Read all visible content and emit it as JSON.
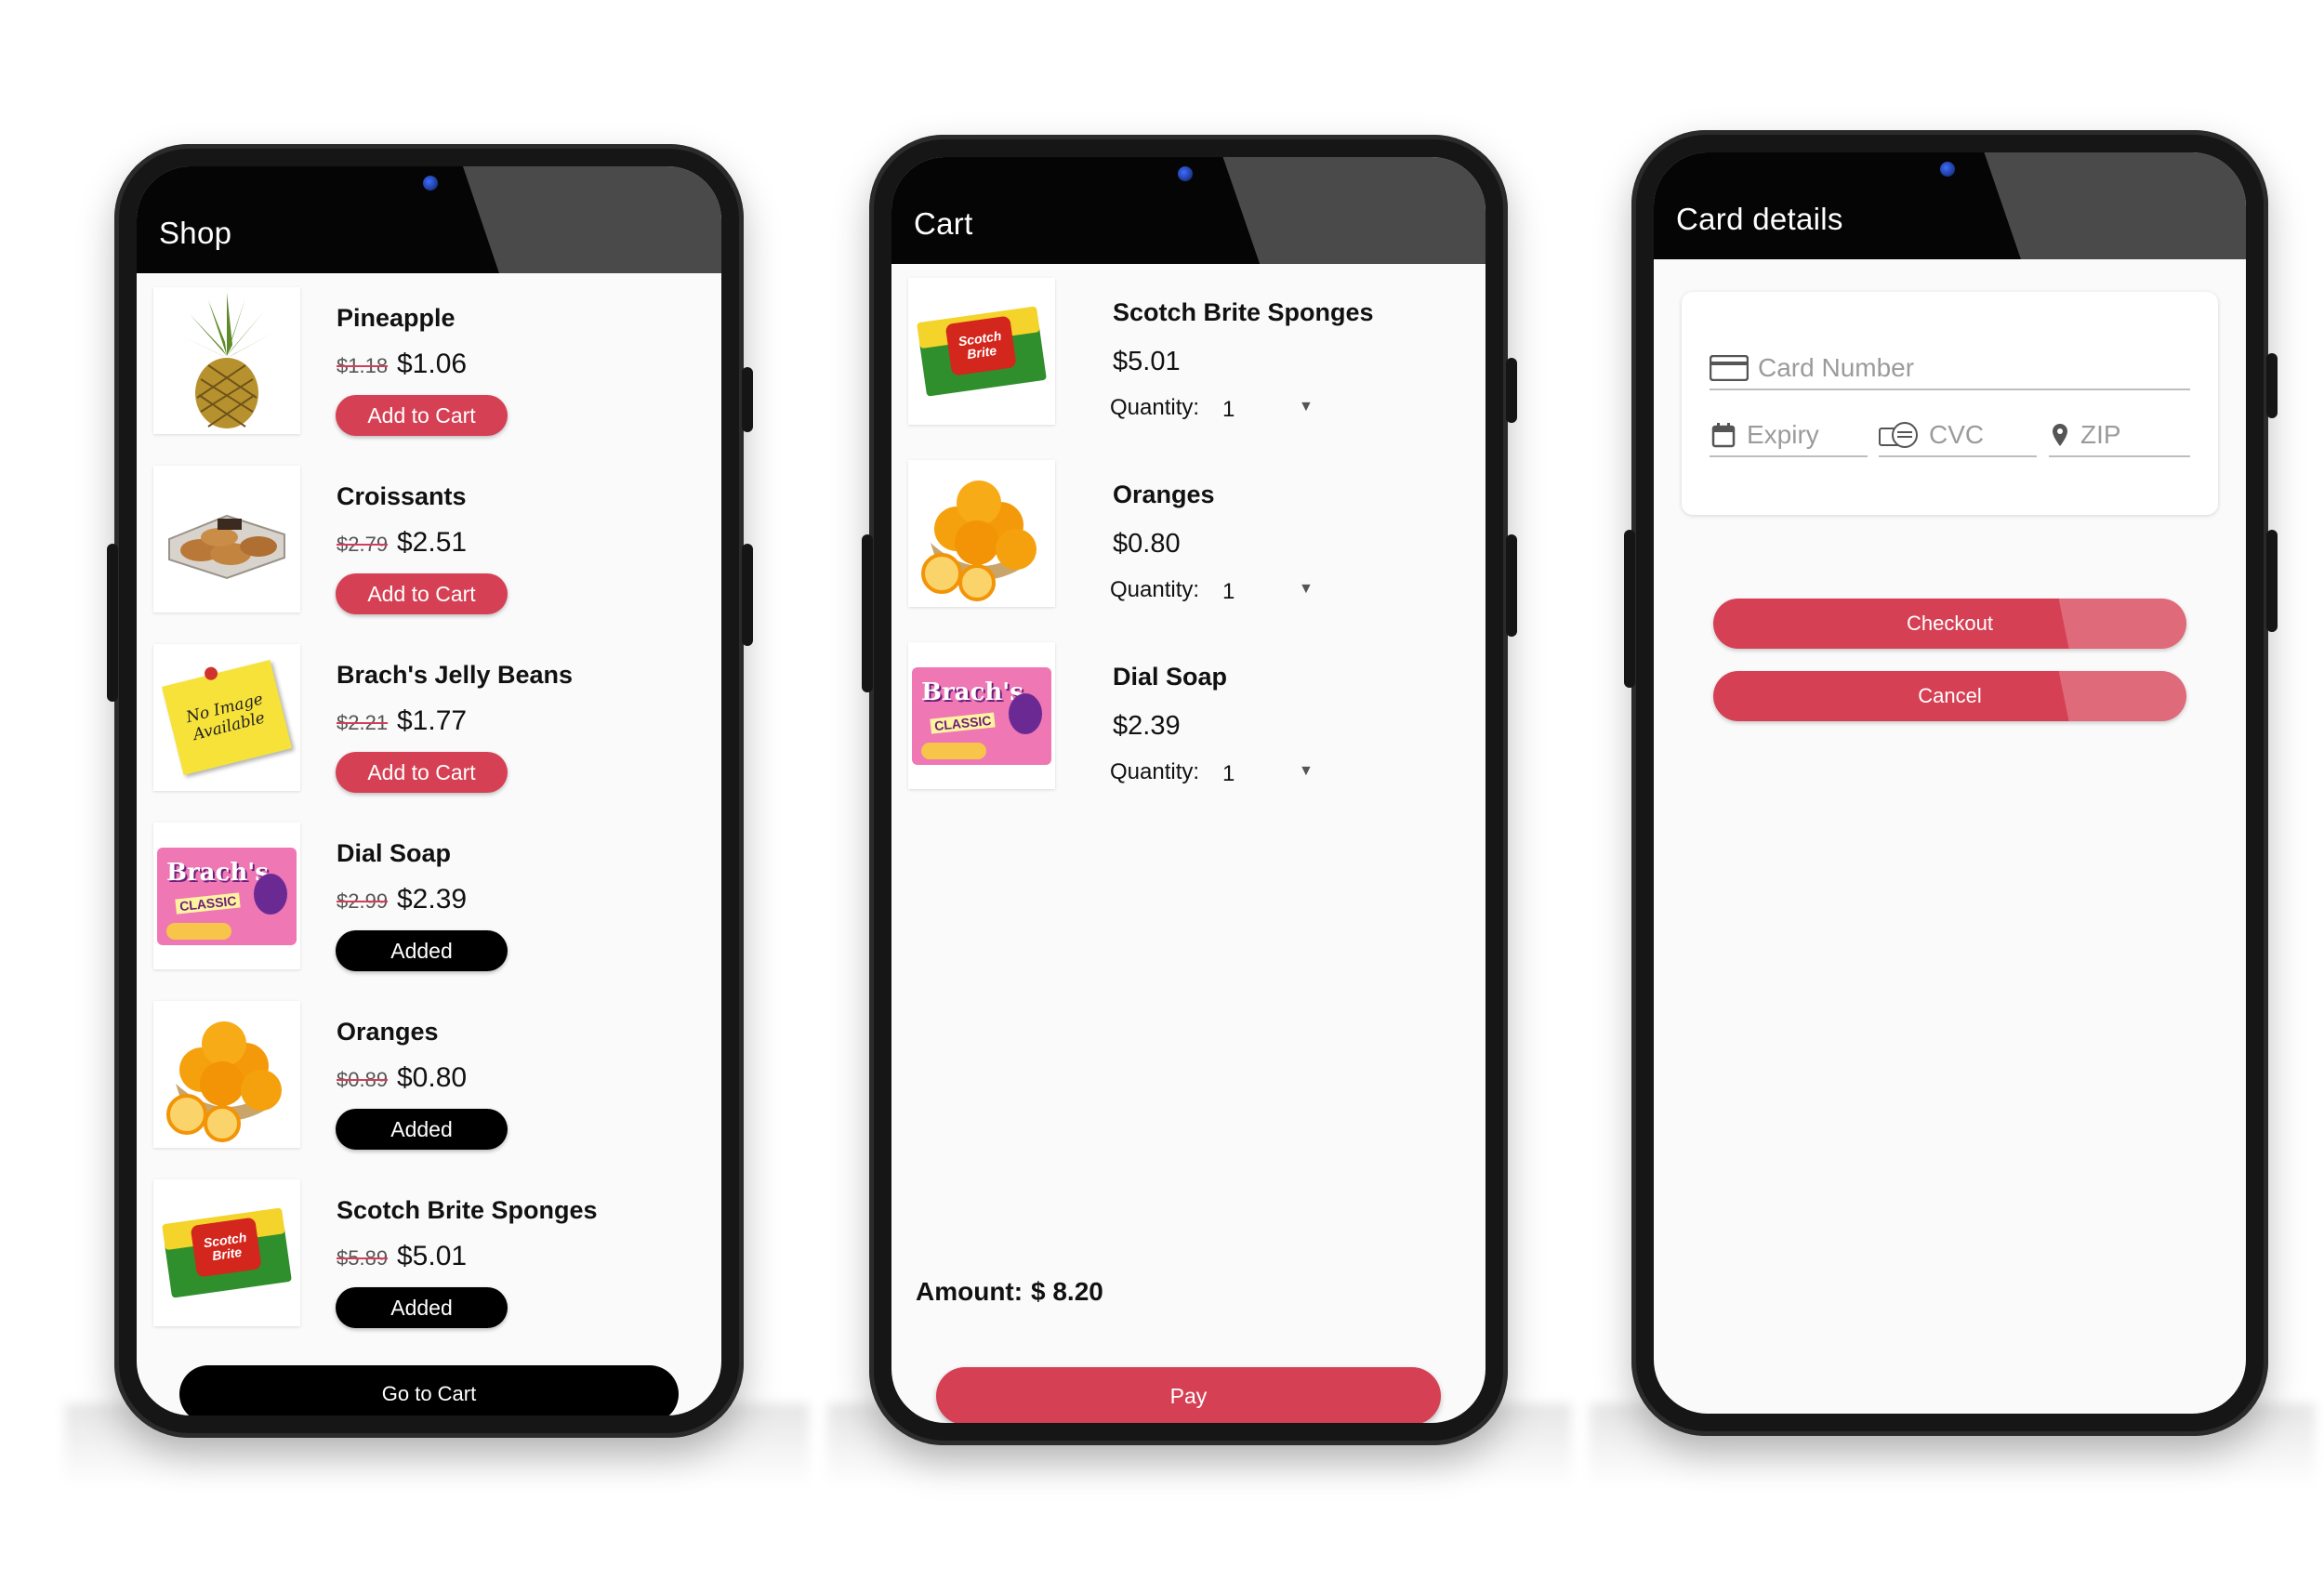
{
  "shop": {
    "title": "Shop",
    "items": [
      {
        "name": "Pineapple",
        "old_price": "$1.18",
        "price": "$1.06",
        "button": "Add to Cart",
        "state": "add",
        "image": "pineapple-image"
      },
      {
        "name": "Croissants",
        "old_price": "$2.79",
        "price": "$2.51",
        "button": "Add to Cart",
        "state": "add",
        "image": "croissants-image"
      },
      {
        "name": "Brach's Jelly Beans",
        "old_price": "$2.21",
        "price": "$1.77",
        "button": "Add to Cart",
        "state": "add",
        "image": "no-image-note"
      },
      {
        "name": "Dial Soap",
        "old_price": "$2.99",
        "price": "$2.39",
        "button": "Added",
        "state": "added",
        "image": "brachs-bag-image"
      },
      {
        "name": "Oranges",
        "old_price": "$0.89",
        "price": "$0.80",
        "button": "Added",
        "state": "added",
        "image": "oranges-image"
      },
      {
        "name": "Scotch Brite Sponges",
        "old_price": "$5.89",
        "price": "$5.01",
        "button": "Added",
        "state": "added",
        "image": "sponges-image"
      }
    ],
    "no_image_text_1": "No Image",
    "no_image_text_2": "Available",
    "go_to_cart": "Go to Cart"
  },
  "cart": {
    "title": "Cart",
    "quantity_label": "Quantity:",
    "items": [
      {
        "name": "Scotch Brite Sponges",
        "price": "$5.01",
        "quantity": "1",
        "image": "sponges-image"
      },
      {
        "name": "Oranges",
        "price": "$0.80",
        "quantity": "1",
        "image": "oranges-image"
      },
      {
        "name": "Dial Soap",
        "price": "$2.39",
        "quantity": "1",
        "image": "brachs-bag-image"
      }
    ],
    "amount_label": "Amount:",
    "amount_value": "$ 8.20",
    "pay": "Pay"
  },
  "card": {
    "title": "Card details",
    "card_number_placeholder": "Card Number",
    "expiry_placeholder": "Expiry",
    "cvc_placeholder": "CVC",
    "zip_placeholder": "ZIP",
    "checkout": "Checkout",
    "cancel": "Cancel"
  },
  "product_text": {
    "brachs": "Brach's",
    "classic": "CLASSIC",
    "scotch": "Scotch",
    "brite": "Brite"
  },
  "colors": {
    "accent": "#d64054",
    "appbar_dark": "#050505",
    "appbar_light": "#4a4a4a",
    "added_button": "#000000"
  }
}
